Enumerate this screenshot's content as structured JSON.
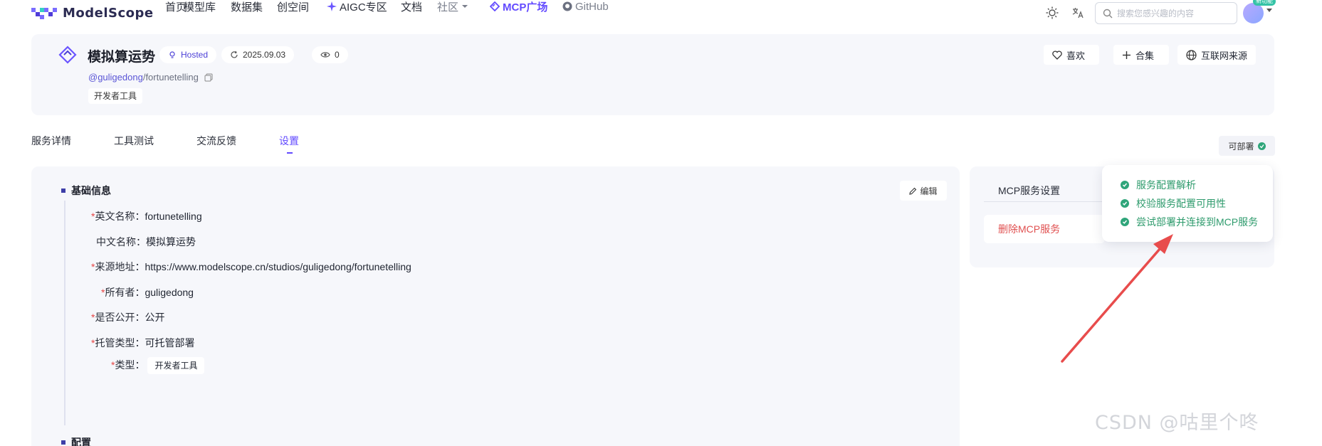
{
  "brand": {
    "name": "ModelScope"
  },
  "nav": {
    "items": [
      {
        "label": "首页"
      },
      {
        "label": "模型库"
      },
      {
        "label": "数据集"
      },
      {
        "label": "创空间"
      },
      {
        "label": "AIGC专区"
      },
      {
        "label": "文档"
      },
      {
        "label": "社区"
      },
      {
        "label": "MCP广场"
      },
      {
        "label": "GitHub"
      }
    ],
    "search_placeholder": "搜索您感兴趣的内容",
    "new_badge": "新功能"
  },
  "header": {
    "title": "模拟算运势",
    "hosted": "Hosted",
    "date": "2025.09.03",
    "views": "0",
    "owner_handle": "@guligedong",
    "owner_repo": "/fortunetelling",
    "tag": "开发者工具",
    "like_label": "喜欢",
    "collect_label": "合集",
    "source_label": "互联网来源"
  },
  "tabs": [
    {
      "label": "服务详情"
    },
    {
      "label": "工具测试"
    },
    {
      "label": "交流反馈"
    },
    {
      "label": "设置"
    }
  ],
  "deploy_status": "可部署",
  "basic_info": {
    "title": "基础信息",
    "edit_label": "编辑",
    "fields": [
      {
        "label": "英文名称：",
        "value": "fortunetelling",
        "required": "*"
      },
      {
        "label": "中文名称：",
        "value": "模拟算运势",
        "required": ""
      },
      {
        "label": "来源地址：",
        "value": "https://www.modelscope.cn/studios/guligedong/fortunetelling",
        "required": "*"
      },
      {
        "label": "所有者：",
        "value": "guligedong",
        "required": "*"
      },
      {
        "label": "是否公开：",
        "value": "公开",
        "required": "*"
      },
      {
        "label": "托管类型：",
        "value": "可托管部署",
        "required": "*"
      },
      {
        "label": "类型：",
        "value": "开发者工具",
        "required": "*"
      }
    ]
  },
  "config_title": "配置",
  "mcp_settings": {
    "title": "MCP服务设置",
    "delete_label": "删除MCP服务"
  },
  "popover": {
    "items": [
      {
        "label": "服务配置解析"
      },
      {
        "label": "校验服务配置可用性"
      },
      {
        "label": "尝试部署并连接到MCP服务"
      }
    ]
  },
  "watermark": "CSDN @咕里个咚",
  "colors": {
    "accent": "#624aff",
    "success": "#2fa57a",
    "danger": "#e05050",
    "annotation_arrow": "#e84c4c"
  }
}
